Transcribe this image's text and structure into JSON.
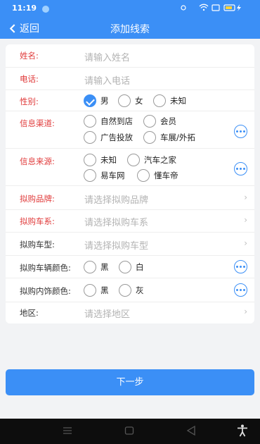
{
  "status": {
    "time": "11:19"
  },
  "header": {
    "back_label": "返回",
    "title": "添加线索"
  },
  "form": {
    "name": {
      "label": "姓名:",
      "placeholder": "请输入姓名"
    },
    "phone": {
      "label": "电话:",
      "placeholder": "请输入电话"
    },
    "gender": {
      "label": "性别:",
      "options": [
        "男",
        "女",
        "未知"
      ],
      "selected": "男"
    },
    "channel": {
      "label": "信息渠道:",
      "options": [
        "自然到店",
        "会员",
        "广告投放",
        "车展/外拓"
      ]
    },
    "source": {
      "label": "信息来源:",
      "options": [
        "未知",
        "汽车之家",
        "易车网",
        "懂车帝"
      ]
    },
    "brand": {
      "label": "拟购品牌:",
      "placeholder": "请选择拟购品牌"
    },
    "series": {
      "label": "拟购车系:",
      "placeholder": "请选择拟购车系"
    },
    "model": {
      "label": "拟购车型:",
      "placeholder": "请选择拟购车型"
    },
    "exterior": {
      "label": "拟购车辆颜色:",
      "options": [
        "黑",
        "白"
      ]
    },
    "interior": {
      "label": "拟购内饰颜色:",
      "options": [
        "黑",
        "灰"
      ]
    },
    "region": {
      "label": "地区:",
      "placeholder": "请选择地区"
    }
  },
  "next_button": "下一步",
  "colors": {
    "primary": "#3b8ff6",
    "required_label": "#e03b3b"
  }
}
